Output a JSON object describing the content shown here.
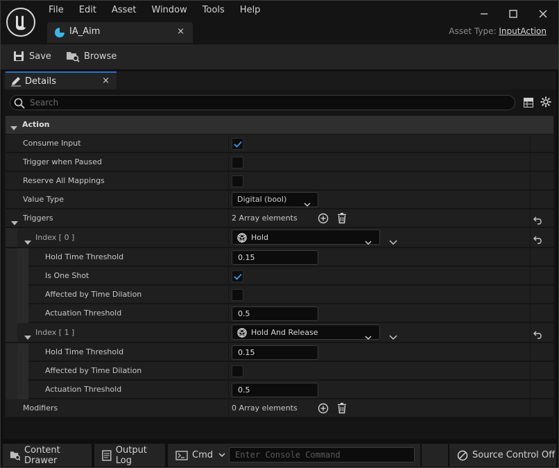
{
  "menu": [
    "File",
    "Edit",
    "Asset",
    "Window",
    "Tools",
    "Help"
  ],
  "asset_tab": {
    "label": "IA_Aim",
    "close": "×"
  },
  "asset_type": {
    "label": "Asset Type:",
    "value": "InputAction"
  },
  "toolbar": {
    "save_label": "Save",
    "browse_label": "Browse"
  },
  "details_tab": {
    "label": "Details",
    "close": "×"
  },
  "search": {
    "placeholder": "Search"
  },
  "category": {
    "label": "Action"
  },
  "rows": {
    "consume_input": {
      "label": "Consume Input",
      "checked": true
    },
    "trigger_when_paused": {
      "label": "Trigger when Paused",
      "checked": false
    },
    "reserve_all_mappings": {
      "label": "Reserve All Mappings",
      "checked": false
    },
    "value_type": {
      "label": "Value Type",
      "value": "Digital (bool)"
    },
    "triggers": {
      "label": "Triggers",
      "count_text": "2 Array elements"
    },
    "index0": {
      "label": "Index [ 0 ]",
      "trigger": "Hold",
      "hold_time_label": "Hold Time Threshold",
      "hold_time_value": "0.15",
      "one_shot_label": "Is One Shot",
      "one_shot_checked": true,
      "time_dilation_label": "Affected by Time Dilation",
      "time_dilation_checked": false,
      "actuation_label": "Actuation Threshold",
      "actuation_value": "0.5"
    },
    "index1": {
      "label": "Index [ 1 ]",
      "trigger": "Hold And Release",
      "hold_time_label": "Hold Time Threshold",
      "hold_time_value": "0.15",
      "time_dilation_label": "Affected by Time Dilation",
      "time_dilation_checked": false,
      "actuation_label": "Actuation Threshold",
      "actuation_value": "0.5"
    },
    "modifiers": {
      "label": "Modifiers",
      "count_text": "0 Array elements"
    }
  },
  "statusbar": {
    "content_drawer": "Content Drawer",
    "output_log": "Output Log",
    "cmd": "Cmd",
    "console_placeholder": "Enter Console Command",
    "source_control": "Source Control Off"
  },
  "colors": {
    "accent": "#2a70c8",
    "check": "#3b8fe0",
    "background": "#151515",
    "row": "#1f1f1f"
  }
}
